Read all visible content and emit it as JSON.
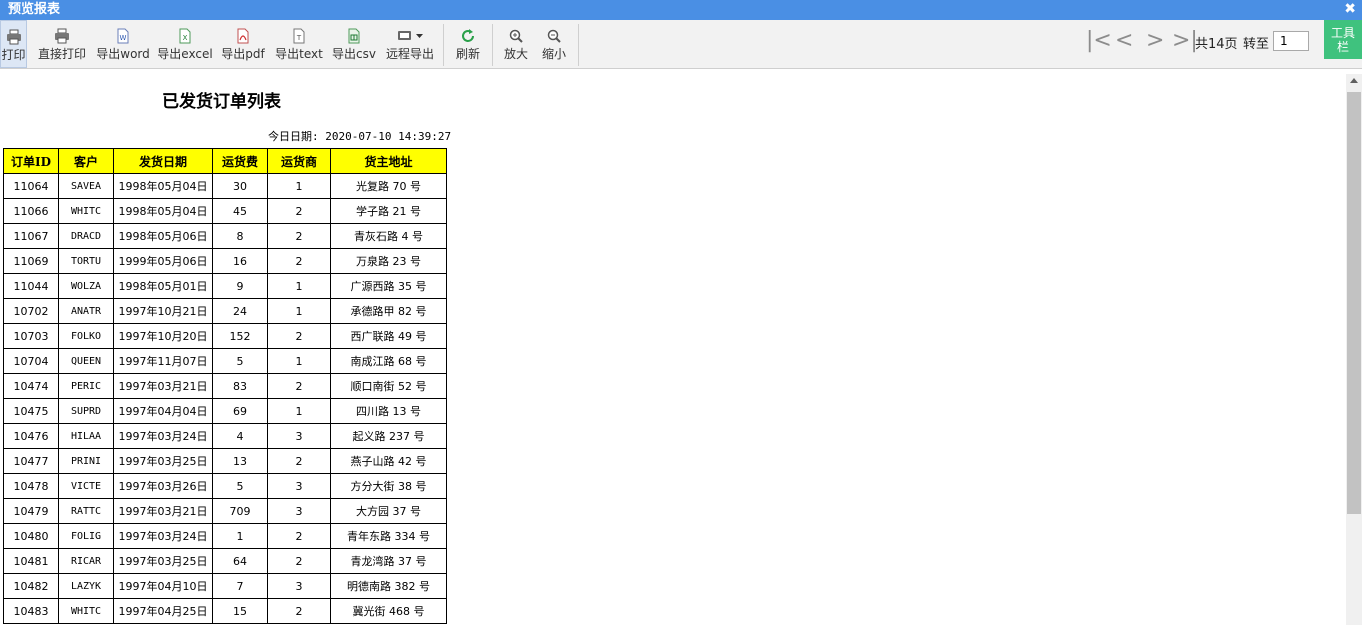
{
  "window": {
    "title": "预览报表",
    "close_glyph": "✖"
  },
  "toolbar": {
    "buttons": [
      {
        "id": "print",
        "label": "打印",
        "icon": "printer-icon"
      },
      {
        "id": "direct_print",
        "label": "直接打印",
        "icon": "printer-icon"
      },
      {
        "id": "export_word",
        "label": "导出word",
        "icon": "word-file-icon"
      },
      {
        "id": "export_excel",
        "label": "导出excel",
        "icon": "excel-file-icon"
      },
      {
        "id": "export_pdf",
        "label": "导出pdf",
        "icon": "pdf-file-icon"
      },
      {
        "id": "export_text",
        "label": "导出text",
        "icon": "text-file-icon"
      },
      {
        "id": "export_csv",
        "label": "导出csv",
        "icon": "csv-file-icon"
      },
      {
        "id": "remote_export",
        "label": "远程导出",
        "icon": "remote-export-icon"
      },
      {
        "id": "refresh",
        "label": "刷新",
        "icon": "refresh-icon"
      },
      {
        "id": "zoom_in",
        "label": "放大",
        "icon": "zoom-in-icon"
      },
      {
        "id": "zoom_out",
        "label": "缩小",
        "icon": "zoom-out-icon"
      }
    ],
    "nav": {
      "first": "|<",
      "prev": "<",
      "next": ">",
      "last": ">|"
    },
    "page_total": "共14页",
    "goto_label": "转至",
    "page_value": "1",
    "tool_panel_line1": "工具",
    "tool_panel_line2": "栏"
  },
  "report": {
    "title": "已发货订单列表",
    "date_line": "今日日期: 2020-07-10 14:39:27",
    "columns": [
      "订单ID",
      "客户",
      "发货日期",
      "运货费",
      "运货商",
      "货主地址"
    ],
    "rows": [
      [
        "11064",
        "SAVEA",
        "1998年05月04日",
        "30",
        "1",
        "光复路 70 号"
      ],
      [
        "11066",
        "WHITC",
        "1998年05月04日",
        "45",
        "2",
        "学子路 21 号"
      ],
      [
        "11067",
        "DRACD",
        "1998年05月06日",
        "8",
        "2",
        "青灰石路 4 号"
      ],
      [
        "11069",
        "TORTU",
        "1999年05月06日",
        "16",
        "2",
        "万泉路 23 号"
      ],
      [
        "11044",
        "WOLZA",
        "1998年05月01日",
        "9",
        "1",
        "广源西路 35 号"
      ],
      [
        "10702",
        "ANATR",
        "1997年10月21日",
        "24",
        "1",
        "承德路甲 82 号"
      ],
      [
        "10703",
        "FOLKO",
        "1997年10月20日",
        "152",
        "2",
        "西广联路 49 号"
      ],
      [
        "10704",
        "QUEEN",
        "1997年11月07日",
        "5",
        "1",
        "南成江路 68 号"
      ],
      [
        "10474",
        "PERIC",
        "1997年03月21日",
        "83",
        "2",
        "顺口南街 52 号"
      ],
      [
        "10475",
        "SUPRD",
        "1997年04月04日",
        "69",
        "1",
        "四川路 13 号"
      ],
      [
        "10476",
        "HILAA",
        "1997年03月24日",
        "4",
        "3",
        "起义路 237 号"
      ],
      [
        "10477",
        "PRINI",
        "1997年03月25日",
        "13",
        "2",
        "燕子山路 42 号"
      ],
      [
        "10478",
        "VICTE",
        "1997年03月26日",
        "5",
        "3",
        "方分大街 38 号"
      ],
      [
        "10479",
        "RATTC",
        "1997年03月21日",
        "709",
        "3",
        "大方园 37 号"
      ],
      [
        "10480",
        "FOLIG",
        "1997年03月24日",
        "1",
        "2",
        "青年东路 334 号"
      ],
      [
        "10481",
        "RICAR",
        "1997年03月25日",
        "64",
        "2",
        "青龙湾路 37 号"
      ],
      [
        "10482",
        "LAZYK",
        "1997年04月10日",
        "7",
        "3",
        "明德南路 382 号"
      ],
      [
        "10483",
        "WHITC",
        "1997年04月25日",
        "15",
        "2",
        "冀光街 468 号"
      ]
    ]
  },
  "colors": {
    "title_bar": "#4a8fe4",
    "header_fill": "#ffff00",
    "tool_panel": "#3fc27e"
  }
}
